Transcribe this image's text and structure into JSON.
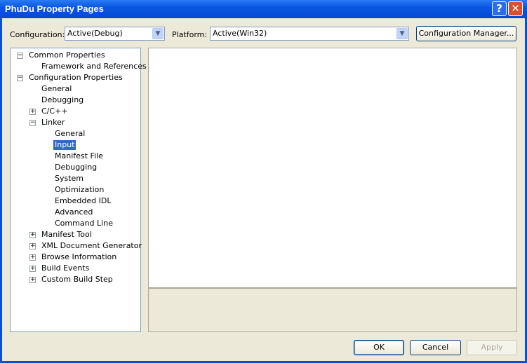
{
  "window": {
    "title": "PhuDu Property Pages",
    "help_icon": "?",
    "close_icon": "✕"
  },
  "toolbar": {
    "configuration_label": "Configuration:",
    "configuration_value": "Active(Debug)",
    "platform_label": "Platform:",
    "platform_value": "Active(Win32)",
    "config_manager": "Configuration Manager..."
  },
  "tree": [
    {
      "label": "Common Properties",
      "level": 0,
      "expander": "minus"
    },
    {
      "label": "Framework and References",
      "level": 1
    },
    {
      "label": "Configuration Properties",
      "level": 0,
      "expander": "minus"
    },
    {
      "label": "General",
      "level": 1
    },
    {
      "label": "Debugging",
      "level": 1
    },
    {
      "label": "C/C++",
      "level": 1,
      "expander": "plus"
    },
    {
      "label": "Linker",
      "level": 1,
      "expander": "minus"
    },
    {
      "label": "General",
      "level": 2
    },
    {
      "label": "Input",
      "level": 2,
      "selected": true
    },
    {
      "label": "Manifest File",
      "level": 2
    },
    {
      "label": "Debugging",
      "level": 2
    },
    {
      "label": "System",
      "level": 2
    },
    {
      "label": "Optimization",
      "level": 2
    },
    {
      "label": "Embedded IDL",
      "level": 2
    },
    {
      "label": "Advanced",
      "level": 2
    },
    {
      "label": "Command Line",
      "level": 2
    },
    {
      "label": "Manifest Tool",
      "level": 1,
      "expander": "plus"
    },
    {
      "label": "XML Document Generator",
      "level": 1,
      "expander": "plus"
    },
    {
      "label": "Browse Information",
      "level": 1,
      "expander": "plus"
    },
    {
      "label": "Build Events",
      "level": 1,
      "expander": "plus"
    },
    {
      "label": "Custom Build Step",
      "level": 1,
      "expander": "plus"
    }
  ],
  "buttons": {
    "ok": "OK",
    "cancel": "Cancel",
    "apply": "Apply"
  }
}
